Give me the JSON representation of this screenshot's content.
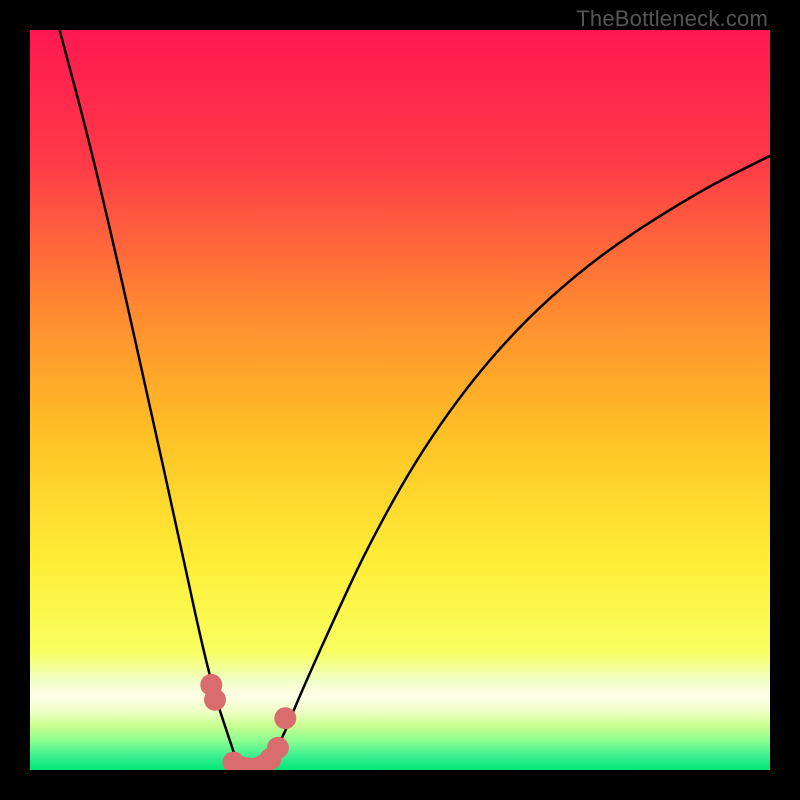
{
  "watermark": "TheBottleneck.com",
  "colors": {
    "gradient_top": "#ff1850",
    "gradient_mid1": "#ff6a35",
    "gradient_mid2": "#ffc225",
    "gradient_mid3": "#ffee38",
    "gradient_green_light": "#b8ff70",
    "gradient_green": "#00e67a",
    "curve_stroke": "#000000",
    "marker_fill": "#d96d6d",
    "frame": "#000000"
  },
  "chart_data": {
    "type": "line",
    "title": "",
    "xlabel": "",
    "ylabel": "",
    "xlim": [
      0,
      100
    ],
    "ylim": [
      0,
      100
    ],
    "series": [
      {
        "name": "bottleneck-curve",
        "x": [
          4,
          8,
          12,
          16,
          20,
          23,
          25,
          27,
          28,
          29,
          30,
          32,
          34,
          36,
          40,
          46,
          54,
          64,
          76,
          90,
          100
        ],
        "values": [
          100,
          85,
          68,
          50,
          32,
          18,
          10,
          4,
          1,
          0,
          0,
          1,
          4,
          9,
          18,
          31,
          45,
          58,
          69,
          78,
          83
        ]
      }
    ],
    "markers": {
      "name": "highlight-points",
      "x": [
        24.5,
        25.0,
        27.5,
        28.5,
        29.5,
        30.5,
        31.5,
        32.5,
        33.5,
        34.5
      ],
      "values": [
        11.5,
        9.5,
        1.0,
        0.4,
        0.2,
        0.2,
        0.6,
        1.5,
        3.0,
        7.0
      ]
    }
  }
}
